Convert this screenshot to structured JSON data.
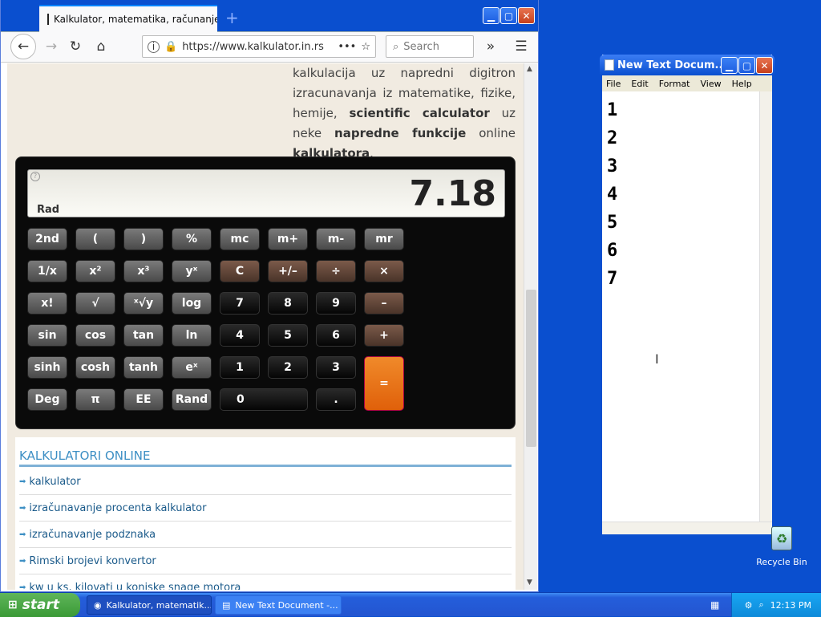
{
  "browser": {
    "tab_title": "Kalkulator, matematika, računanje",
    "new_tab_symbol": "+",
    "url": "https://www.kalkulator.in.rs",
    "search_placeholder": "Search",
    "buttons": {
      "minimize": "_",
      "maximize": "□",
      "close": "×"
    }
  },
  "page": {
    "intro_parts": [
      {
        "text": "kalkulacija uz napredni digitron izracunavanja iz matematike, fizike, hemije, ",
        "bold": false
      },
      {
        "text": "scientific calculator",
        "bold": true
      },
      {
        "text": " uz neke ",
        "bold": false
      },
      {
        "text": "napredne funkcije",
        "bold": true
      },
      {
        "text": " online ",
        "bold": false
      },
      {
        "text": "kalkulatora",
        "bold": true
      },
      {
        "text": ".",
        "bold": false
      }
    ],
    "calculator": {
      "display_value": "7.18",
      "angle_mode": "Rad",
      "help_glyph": "?",
      "rows": [
        [
          "2nd",
          "(",
          ")",
          "%",
          "mc",
          "m+",
          "m-",
          "mr"
        ],
        [
          "1/x",
          "x²",
          "x³",
          "yˣ",
          "C",
          "+/–",
          "÷",
          "×"
        ],
        [
          "x!",
          "√",
          "ˣ√y",
          "log",
          "7",
          "8",
          "9",
          "–"
        ],
        [
          "sin",
          "cos",
          "tan",
          "ln",
          "4",
          "5",
          "6",
          "+"
        ],
        [
          "sinh",
          "cosh",
          "tanh",
          "eˣ",
          "1",
          "2",
          "3",
          "="
        ],
        [
          "Deg",
          "π",
          "EE",
          "Rand",
          "0",
          "."
        ]
      ]
    },
    "links_section": {
      "title": "KALKULATORI ONLINE",
      "items": [
        "kalkulator",
        "izračunavanje procenta kalkulator",
        "izračunavanje podznaka",
        "Rimski brojevi konvertor",
        "kw u ks, kilovati u konjske snage motora"
      ]
    }
  },
  "notepad": {
    "title": "New Text Docum...",
    "menu": [
      "File",
      "Edit",
      "Format",
      "View",
      "Help"
    ],
    "lines": [
      "1",
      "2",
      "3",
      "4",
      "5",
      "6",
      "7"
    ]
  },
  "desktop": {
    "recycle_bin_label": "Recycle Bin"
  },
  "taskbar": {
    "start_label": "start",
    "tasks": [
      "Kalkulator, matematik...",
      "New Text Document -..."
    ],
    "clock": "12:13 PM"
  }
}
